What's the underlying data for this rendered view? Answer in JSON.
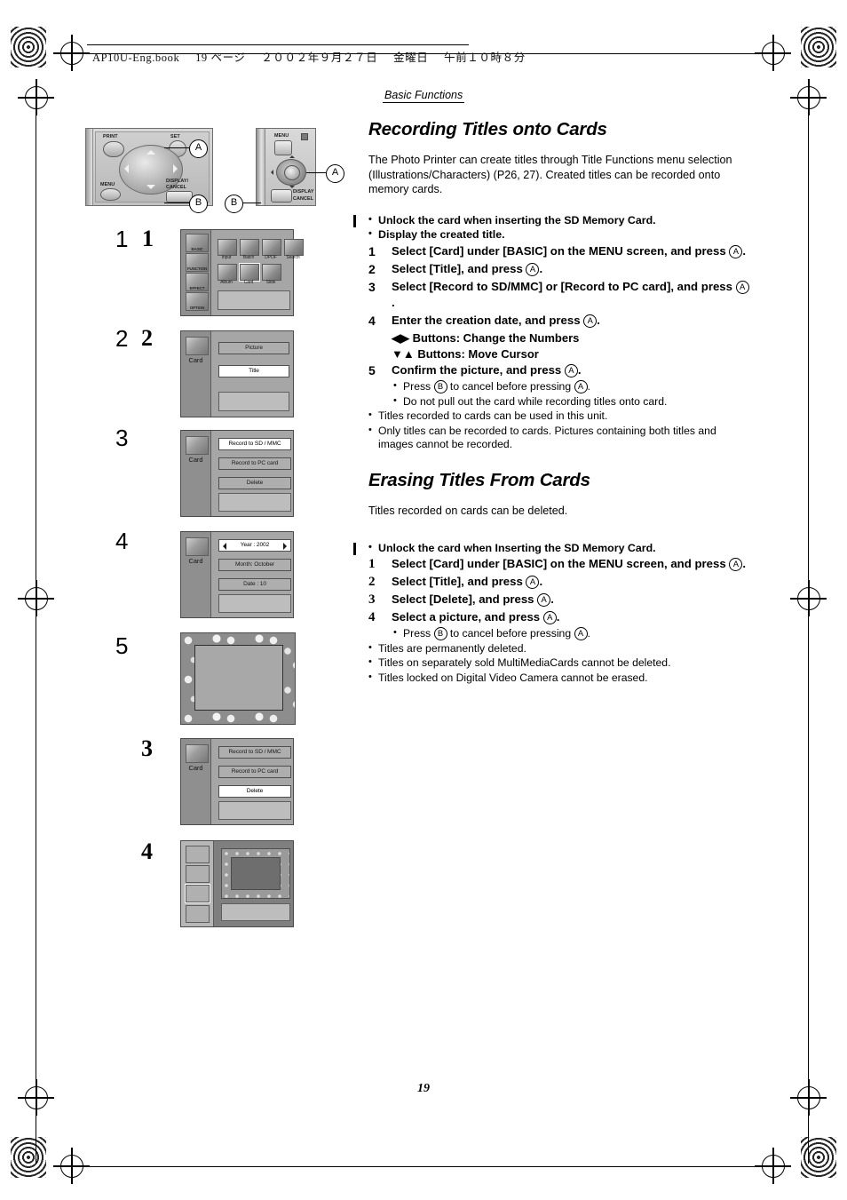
{
  "header": {
    "filename": "AP10U-Eng.book",
    "page_marker": "19 ページ",
    "date": "２００２年９月２７日",
    "weekday": "金曜日",
    "time": "午前１０時８分"
  },
  "running_head": "Basic Functions",
  "page_number": "19",
  "section1": {
    "title": "Recording Titles onto Cards",
    "intro": "The Photo Printer can create titles through Title Functions menu selection (Illustrations/Characters) (P26, 27). Created titles can be recorded onto memory cards.",
    "pre_bullets": [
      "Unlock the card when inserting the SD Memory Card.",
      "Display the created title."
    ],
    "steps": [
      {
        "num": "1",
        "text_before": "Select [Card] under [BASIC] on the MENU screen, and press ",
        "badge": "A",
        "text_after": "."
      },
      {
        "num": "2",
        "text_before": "Select [Title], and press ",
        "badge": "A",
        "text_after": "."
      },
      {
        "num": "3",
        "text_before": "Select [Record to SD/MMC] or [Record to PC card], and press ",
        "badge": "A",
        "text_after": "."
      },
      {
        "num": "4",
        "text_before": "Enter the creation date, and press ",
        "badge": "A",
        "text_after": "."
      },
      {
        "num": "5",
        "text_before": "Confirm the picture, and press ",
        "badge": "A",
        "text_after": "."
      }
    ],
    "step4_subs": [
      "◀▶ Buttons: Change the Numbers",
      "▼▲ Buttons: Move Cursor"
    ],
    "step5_notes_before": "Press ",
    "step5_notes_badge1": "B",
    "step5_notes_mid": " to cancel before pressing ",
    "step5_notes_badge2": "A",
    "step5_notes_after": ".",
    "step5_note2": "Do not pull out the card while recording titles onto card.",
    "post_bullets": [
      "Titles recorded to cards can be used in this unit.",
      "Only titles can be recorded to cards. Pictures containing both titles and images cannot be recorded."
    ]
  },
  "section2": {
    "title": "Erasing Titles From Cards",
    "intro": "Titles recorded on cards can be deleted.",
    "pre_bullets": [
      "Unlock the card when Inserting the SD Memory Card."
    ],
    "steps": [
      {
        "num": "1",
        "text_before": "Select [Card] under [BASIC] on the MENU screen, and press ",
        "badge": "A",
        "text_after": "."
      },
      {
        "num": "2",
        "text_before": "Select [Title], and press ",
        "badge": "A",
        "text_after": "."
      },
      {
        "num": "3",
        "text_before": "Select [Delete], and press ",
        "badge": "A",
        "text_after": "."
      },
      {
        "num": "4",
        "text_before": "Select a picture, and press ",
        "badge": "A",
        "text_after": "."
      }
    ],
    "note_before": "Press ",
    "note_badge1": "B",
    "note_mid": " to cancel before pressing ",
    "note_badge2": "A",
    "note_after": ".",
    "post_bullets": [
      "Titles are permanently deleted.",
      "Titles on separately sold MultiMediaCards cannot be deleted.",
      "Titles locked on Digital Video Camera cannot be erased."
    ]
  },
  "panel": {
    "print_label": "PRINT",
    "set_label": "SET",
    "menu_label": "MENU",
    "display_label": "DISPLAY/",
    "cancel_label": "CANCEL",
    "menu_label2": "MENU",
    "display_label2": "DISPLAY",
    "cancel_label2": "CANCEL",
    "callout_a": "A",
    "callout_b": "B"
  },
  "margin_numbers": {
    "rec": [
      "1",
      "2",
      "3",
      "4",
      "5"
    ],
    "era": [
      "1",
      "2",
      "3",
      "4"
    ]
  },
  "screens": {
    "menu": {
      "tabs": [
        "BASIC",
        "FUNCTION",
        "EFFECT",
        "OPTION"
      ],
      "row1": [
        "Input",
        "Batch",
        "DPOF",
        "Search"
      ],
      "row2": [
        "Album",
        "Card",
        "Slide"
      ],
      "selected": "Card"
    },
    "title_menu": {
      "card_label": "Card",
      "options": [
        "Picture",
        "Title"
      ],
      "selected": "Title"
    },
    "record_menu": {
      "card_label": "Card",
      "options": [
        "Record to SD / MMC",
        "Record to PC card",
        "Delete"
      ],
      "selected": "Record to SD / MMC"
    },
    "date_menu": {
      "card_label": "Card",
      "year_label": "Year",
      "year_value": "2002",
      "month_label": "Month",
      "month_value": "October",
      "date_label": "Date",
      "date_value": "10",
      "year_row": "Year   :   2002",
      "month_row": "Month: October",
      "date_row": "Date   :    10"
    },
    "delete_menu": {
      "card_label": "Card",
      "options": [
        "Record to SD / MMC",
        "Record to PC card",
        "Delete"
      ],
      "selected": "Delete"
    }
  }
}
